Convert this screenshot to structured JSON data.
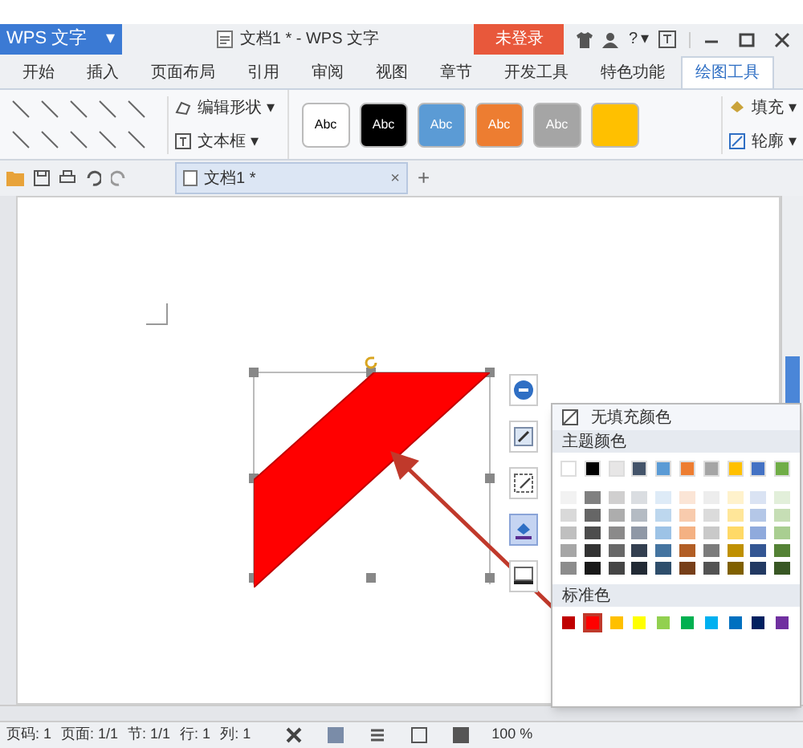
{
  "app_menu": {
    "label": "WPS 文字",
    "caret": "▾"
  },
  "window": {
    "title": "文档1 * - WPS 文字"
  },
  "login_button": "未登录",
  "help": {
    "label": "?",
    "caret": "▾"
  },
  "tabs": [
    {
      "label": "开始",
      "selected": false
    },
    {
      "label": "插入",
      "selected": false
    },
    {
      "label": "页面布局",
      "selected": false
    },
    {
      "label": "引用",
      "selected": false
    },
    {
      "label": "审阅",
      "selected": false
    },
    {
      "label": "视图",
      "selected": false
    },
    {
      "label": "章节",
      "selected": false
    },
    {
      "label": "开发工具",
      "selected": false
    },
    {
      "label": "特色功能",
      "selected": false
    },
    {
      "label": "绘图工具",
      "selected": true
    }
  ],
  "ribbon": {
    "edit_shape": "编辑形状 ▾",
    "text_box": "文本框 ▾",
    "styles": [
      {
        "label": "Abc",
        "color": "#ffffff"
      },
      {
        "label": "Abc",
        "color": "#000000"
      },
      {
        "label": "Abc",
        "color": "#5b9bd5"
      },
      {
        "label": "Abc",
        "color": "#ed7d31"
      },
      {
        "label": "Abc",
        "color": "#a5a5a5"
      },
      {
        "color": "#ffc000"
      }
    ],
    "fill": "填充 ▾",
    "outline": "轮廓 ▾"
  },
  "doc_tab": {
    "label": "文档1 *",
    "close": "×",
    "add": "+"
  },
  "side_tools": [
    {
      "kind": "collapse",
      "selected": false
    },
    {
      "kind": "style",
      "selected": false
    },
    {
      "kind": "outline",
      "selected": false
    },
    {
      "kind": "fill",
      "selected": true
    },
    {
      "kind": "effect",
      "selected": false
    }
  ],
  "color_menu": {
    "no_fill": "无填充颜色",
    "theme_header": "主题颜色",
    "theme_colors": [
      {
        "color": "#ffffff"
      },
      {
        "color": "#000000"
      },
      {
        "color": "#e7e6e6"
      },
      {
        "color": "#44546a"
      },
      {
        "color": "#5b9bd5"
      },
      {
        "color": "#ed7d31"
      },
      {
        "color": "#a5a5a5"
      },
      {
        "color": "#ffc000"
      },
      {
        "color": "#4472c4"
      },
      {
        "color": "#70ad47"
      }
    ],
    "standard_header": "标准色",
    "standard_colors": [
      {
        "color": "#c00000",
        "selected": false
      },
      {
        "color": "#ff0000",
        "selected": true
      },
      {
        "color": "#ffc000",
        "selected": false
      },
      {
        "color": "#ffff00",
        "selected": false
      },
      {
        "color": "#92d050",
        "selected": false
      },
      {
        "color": "#00b050",
        "selected": false
      },
      {
        "color": "#00b0f0",
        "selected": false
      },
      {
        "color": "#0070c0",
        "selected": false
      },
      {
        "color": "#002060",
        "selected": false
      },
      {
        "color": "#7030a0",
        "selected": false
      }
    ]
  },
  "status_bar": {
    "items": [
      "页码: 1",
      "页面: 1/1",
      "节: 1/1",
      "行: 1",
      "列: 1"
    ],
    "zoom": "100 %"
  }
}
